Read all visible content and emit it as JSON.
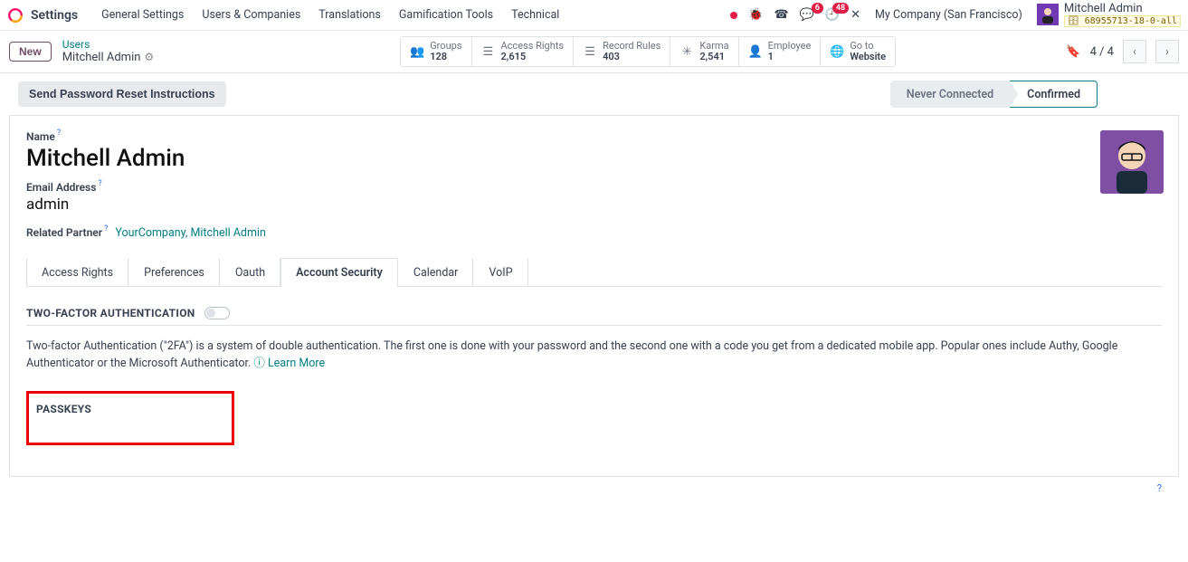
{
  "topnav": {
    "app_title": "Settings",
    "menus": [
      "General Settings",
      "Users & Companies",
      "Translations",
      "Gamification Tools",
      "Technical"
    ],
    "msg_badge": "6",
    "activity_badge": "48",
    "company": "My Company (San Francisco)",
    "user_name": "Mitchell Admin",
    "db": "68955713-18-0-all"
  },
  "ctrl": {
    "new_btn": "New",
    "breadcrumb_top": "Users",
    "breadcrumb_bottom": "Mitchell Admin",
    "stats": [
      {
        "icon": "👥",
        "label": "Groups",
        "value": "128"
      },
      {
        "icon": "☰",
        "label": "Access Rights",
        "value": "2,615"
      },
      {
        "icon": "☰",
        "label": "Record Rules",
        "value": "403"
      },
      {
        "icon": "✳",
        "label": "Karma",
        "value": "2,541"
      },
      {
        "icon": "👤",
        "label": "Employee",
        "value": "1"
      },
      {
        "icon": "🌐",
        "label": "Go to",
        "value": "Website"
      }
    ],
    "pager": "4 / 4"
  },
  "form": {
    "action_btn": "Send Password Reset Instructions",
    "status": {
      "inactive": "Never Connected",
      "active": "Confirmed"
    },
    "name_label": "Name",
    "name_value": "Mitchell Admin",
    "email_label": "Email Address",
    "email_value": "admin",
    "partner_label": "Related Partner",
    "partner_value": "YourCompany, Mitchell Admin",
    "tabs": [
      "Access Rights",
      "Preferences",
      "Oauth",
      "Account Security",
      "Calendar",
      "VoIP"
    ],
    "active_tab": "Account Security",
    "section1": "TWO-FACTOR AUTHENTICATION",
    "section1_desc": "Two-factor Authentication (\"2FA\") is a system of double authentication. The first one is done with your password and the second one with a code you get from a dedicated mobile app. Popular ones include Authy, Google Authenticator or the Microsoft Authenticator. ",
    "learn_more": "Learn More",
    "section2": "PASSKEYS"
  }
}
